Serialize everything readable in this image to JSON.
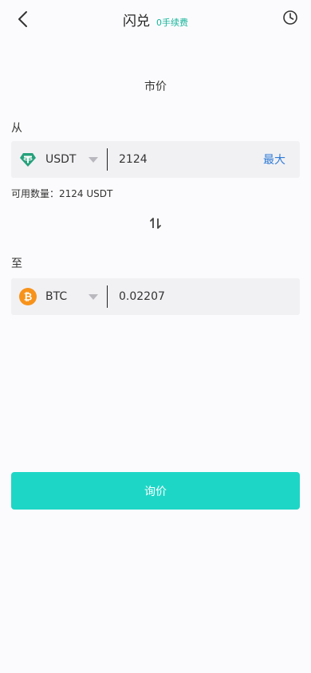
{
  "header": {
    "title": "闪兑",
    "fee_badge": "0手续费",
    "back_icon": "chevron-left-icon",
    "history_icon": "clock-icon"
  },
  "market_label": "市价",
  "from": {
    "label": "从",
    "coin": "USDT",
    "coin_icon": "tether-icon",
    "coin_color": "#26a17b",
    "amount": "2124",
    "max_label": "最大",
    "available": "可用数量：2124 USDT"
  },
  "to": {
    "label": "至",
    "coin": "BTC",
    "coin_icon": "bitcoin-icon",
    "coin_color": "#f7931a",
    "amount": "0.02207"
  },
  "submit_label": "询价",
  "colors": {
    "accent": "#1ed6c6",
    "fee_green": "#17b59a",
    "max_blue": "#2f7bd6"
  }
}
